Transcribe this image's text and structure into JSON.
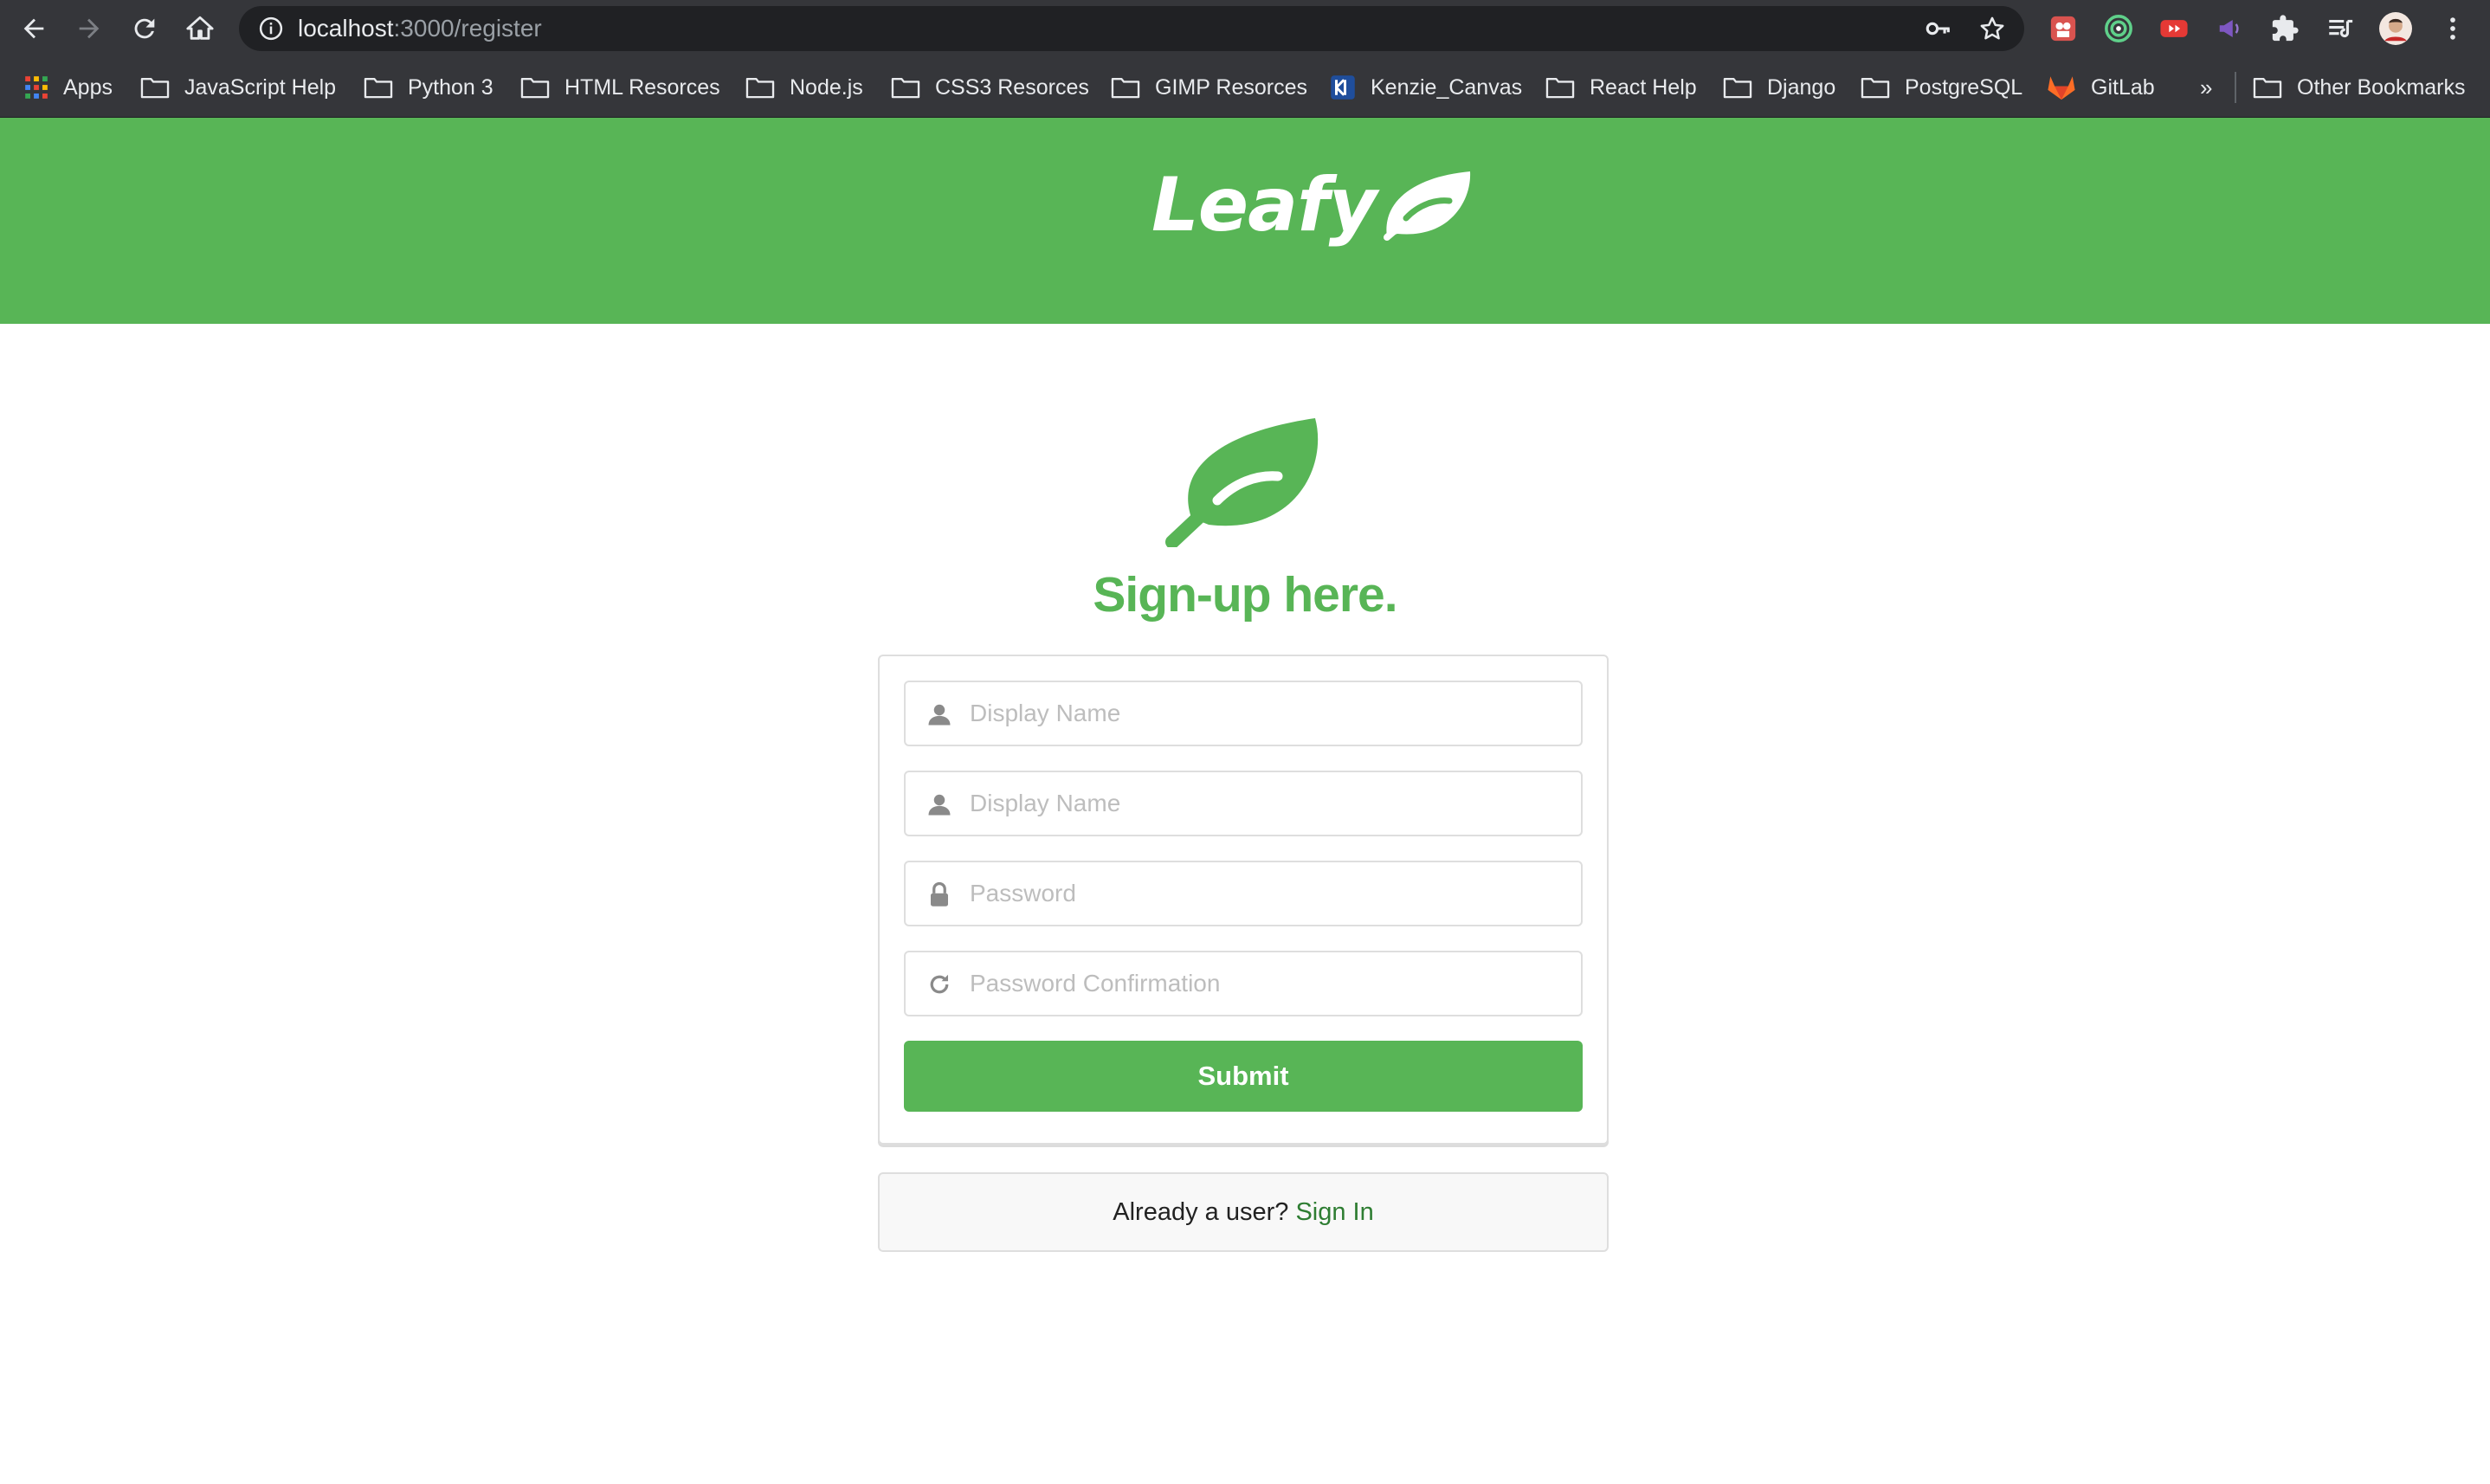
{
  "browser": {
    "url_host": "localhost",
    "url_path": ":3000/register",
    "bookmarks": [
      {
        "label": "Apps",
        "icon": "apps-grid-icon"
      },
      {
        "label": "JavaScript Help",
        "icon": "folder-icon"
      },
      {
        "label": "Python 3",
        "icon": "folder-icon"
      },
      {
        "label": "HTML Resorces",
        "icon": "folder-icon"
      },
      {
        "label": "Node.js",
        "icon": "folder-icon"
      },
      {
        "label": "CSS3 Resorces",
        "icon": "folder-icon"
      },
      {
        "label": "GIMP Resorces",
        "icon": "folder-icon"
      },
      {
        "label": "Kenzie_Canvas",
        "icon": "kenzie-icon"
      },
      {
        "label": "React Help",
        "icon": "folder-icon"
      },
      {
        "label": "Django",
        "icon": "folder-icon"
      },
      {
        "label": "PostgreSQL",
        "icon": "folder-icon"
      },
      {
        "label": "GitLab",
        "icon": "gitlab-icon"
      }
    ],
    "overflow_label": "»",
    "other_bookmarks": "Other Bookmarks"
  },
  "site": {
    "brand": "Leafy",
    "page_title": "Sign-up here.",
    "brand_color": "#58b556"
  },
  "form": {
    "fields": [
      {
        "placeholder": "Display Name",
        "icon": "user-icon",
        "value": ""
      },
      {
        "placeholder": "Display Name",
        "icon": "user-icon",
        "value": ""
      },
      {
        "placeholder": "Password",
        "icon": "lock-icon",
        "value": ""
      },
      {
        "placeholder": "Password Confirmation",
        "icon": "refresh-icon",
        "value": ""
      }
    ],
    "submit_label": "Submit"
  },
  "signin": {
    "prompt": "Already a user?",
    "link_label": "Sign In"
  }
}
